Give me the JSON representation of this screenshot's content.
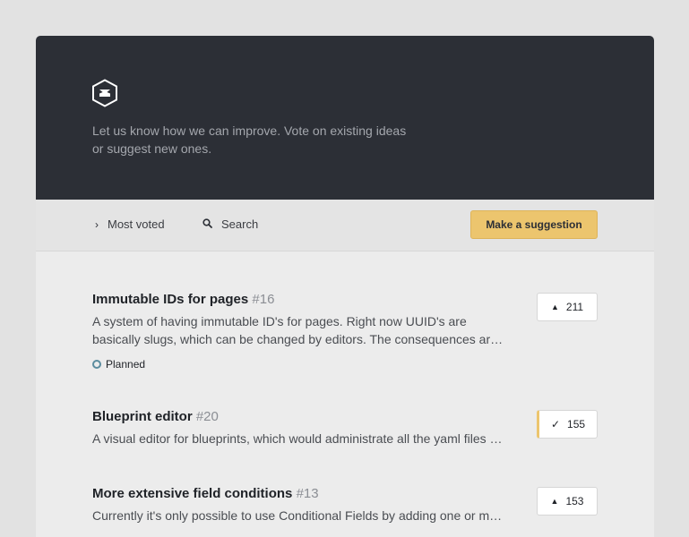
{
  "hero": {
    "logo_icon": "kirby-hexagon-logo-icon",
    "tagline": "Let us know how we can improve. Vote on existing ideas or suggest new ones."
  },
  "toolbar": {
    "sort": {
      "icon": "chevron-right-icon",
      "glyph": "›",
      "label": "Most voted"
    },
    "search": {
      "icon": "search-icon",
      "glyph": "⚲",
      "label": "Search"
    },
    "suggest_button": "Make a suggestion"
  },
  "ideas": [
    {
      "title": "Immutable IDs for pages",
      "number": "#16",
      "description": "A system of having immutable ID's for pages. Right now UUID's are basically slugs, which can be changed by editors. The consequences are that all references break.",
      "status": "Planned",
      "votes": "211",
      "vote_glyph": "▲",
      "voted": false
    },
    {
      "title": "Blueprint editor",
      "number": "#20",
      "description": "A visual editor for blueprints, which would administrate all the yaml files for you.",
      "status": "",
      "votes": "155",
      "vote_glyph": "✓",
      "voted": true
    },
    {
      "title": "More extensive field conditions",
      "number": "#13",
      "description": "Currently it's only possible to use Conditional Fields by adding one or more conditions.",
      "status": "",
      "votes": "153",
      "vote_glyph": "▲",
      "voted": false
    }
  ],
  "colors": {
    "hero_bg": "#2c2f36",
    "accent": "#ecc56e",
    "status_planned": "#5b8c9e"
  }
}
